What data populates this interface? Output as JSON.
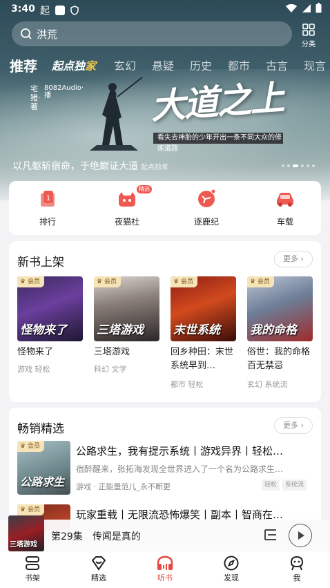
{
  "status": {
    "time": "3:40",
    "carrier_glyph": "起"
  },
  "search": {
    "placeholder": "洪荒"
  },
  "category_label": "分类",
  "tabs": [
    {
      "label": "推荐",
      "active": true
    },
    {
      "label_a": "起点独",
      "label_b": "家"
    },
    {
      "label": "玄幻"
    },
    {
      "label": "悬疑"
    },
    {
      "label": "历史"
    },
    {
      "label": "都市"
    },
    {
      "label": "古言"
    },
    {
      "label": "现言"
    }
  ],
  "banner": {
    "title": "大道之上",
    "author": "宅猪·著",
    "audio": "8082Audio·播",
    "subtitle": "看失去神胎的少年开出一条不同大众的修炼道路",
    "caption": "以凡躯斩宿命，于绝巅证大道",
    "caption_tag": "起点独家",
    "slides": 6,
    "active_slide": 3
  },
  "quick_links": [
    {
      "label": "排行",
      "icon": "ranking-icon",
      "badge": ""
    },
    {
      "label": "夜猫社",
      "icon": "night-cat-icon",
      "badge": "精选"
    },
    {
      "label": "逐鹿纪",
      "icon": "deer-icon",
      "badge": ""
    },
    {
      "label": "车载",
      "icon": "car-icon",
      "badge": ""
    }
  ],
  "new_books": {
    "title": "新书上架",
    "more": "更多",
    "vip_label": "会员",
    "books": [
      {
        "title": "怪物来了",
        "cover_text": "怪物来了",
        "tags": "游戏  轻松"
      },
      {
        "title": "三塔游戏",
        "cover_text": "三塔游戏",
        "tags": "科幻  文学"
      },
      {
        "title": "回乡种田：末世系统早到…",
        "cover_text": "末世系统",
        "tags": "都市  轻松"
      },
      {
        "title": "俗世：我的命格百无禁忌",
        "cover_text": "我的命格",
        "tags": "玄幻  系统流"
      }
    ]
  },
  "bestsellers": {
    "title": "畅销精选",
    "more": "更多",
    "items": [
      {
        "title": "公路求生，我有提示系统丨游戏异界丨轻松…",
        "desc": "宿醉醒来，张拓海发现全世界进入了一个名为公路求生…",
        "meta": "游戏 · 正能量范儿_永不断更",
        "chips": [
          "轻松",
          "系统流"
        ],
        "cover_text": "公路求生"
      },
      {
        "title": "玩家重载丨无限流恐怖爆笑丨副本丨智商在…",
        "cover_text": ""
      }
    ]
  },
  "player": {
    "episode": "第29集",
    "chapter": "传闻是真的",
    "cover_text": "三塔游戏"
  },
  "bottom_nav": [
    {
      "label": "书架",
      "icon": "bookshelf-icon"
    },
    {
      "label": "精选",
      "icon": "featured-icon"
    },
    {
      "label": "听书",
      "icon": "headphones-icon",
      "active": true
    },
    {
      "label": "发现",
      "icon": "compass-icon"
    },
    {
      "label": "我",
      "icon": "profile-icon"
    }
  ],
  "colors": {
    "accent": "#e9473f",
    "vip_bg": "#f6e3b8",
    "exclusive_highlight": "#f2c64b"
  }
}
